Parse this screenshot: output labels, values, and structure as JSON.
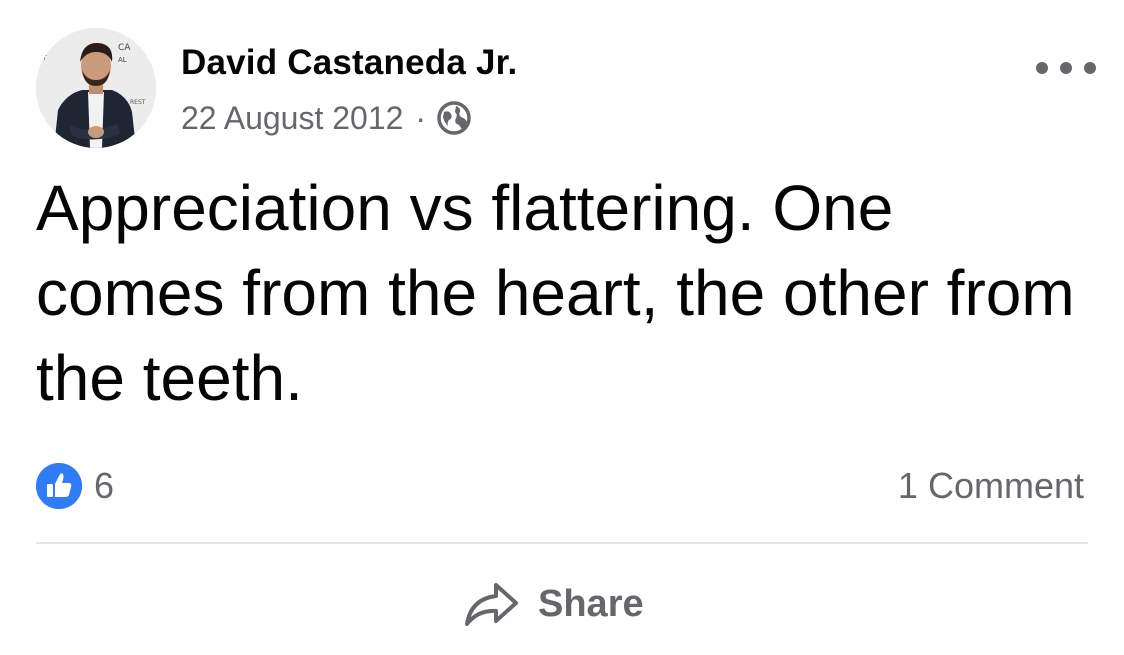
{
  "post": {
    "author": "David Castaneda Jr.",
    "date": "22 August 2012",
    "separator": "·",
    "privacy_icon": "globe-icon",
    "more_icon": "more-horizontal-icon",
    "text": "Appreciation vs flattering. One comes from the heart, the other from the teeth.",
    "reaction_icon": "like-icon",
    "reaction_count": "6",
    "comments_label": "1 Comment"
  },
  "actions": {
    "share_label": "Share",
    "share_icon": "share-arrow-icon"
  },
  "colors": {
    "text_primary": "#050505",
    "text_secondary": "#65676b",
    "like_blue": "#2f7cf6",
    "divider": "#e4e6eb"
  }
}
